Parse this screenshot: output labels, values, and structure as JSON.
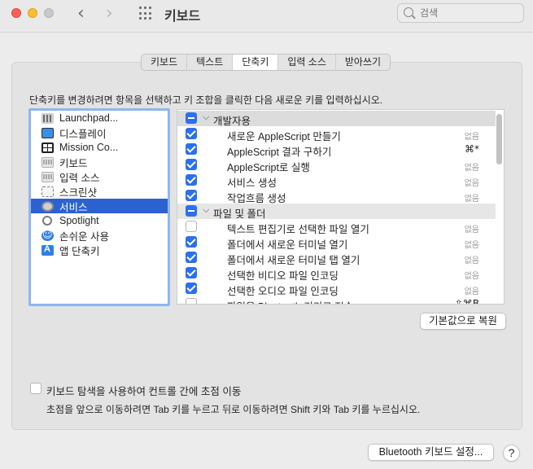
{
  "window": {
    "title": "키보드",
    "search_placeholder": "검색"
  },
  "tabs": [
    {
      "label": "키보드"
    },
    {
      "label": "텍스트"
    },
    {
      "label": "단축키"
    },
    {
      "label": "입력 소스"
    },
    {
      "label": "받아쓰기"
    }
  ],
  "active_tab": "단축키",
  "instruction": "단축키를 변경하려면 항목을 선택하고 키 조합을 클릭한 다음 새로운 키를 입력하십시오.",
  "categories": [
    {
      "label": "Launchpad...",
      "icon": "launchpad-icon"
    },
    {
      "label": "디스플레이",
      "icon": "display-icon"
    },
    {
      "label": "Mission Co...",
      "icon": "mission-control-icon"
    },
    {
      "label": "키보드",
      "icon": "keyboard-icon"
    },
    {
      "label": "입력 소스",
      "icon": "input-source-icon"
    },
    {
      "label": "스크린샷",
      "icon": "screenshot-icon"
    },
    {
      "label": "서비스",
      "icon": "services-icon",
      "selected": true
    },
    {
      "label": "Spotlight",
      "icon": "spotlight-icon"
    },
    {
      "label": "손쉬운 사용",
      "icon": "accessibility-icon"
    },
    {
      "label": "앱 단축키",
      "icon": "app-shortcuts-icon"
    }
  ],
  "shortcuts": [
    {
      "type": "group",
      "label": "개발자용",
      "state": "mixed"
    },
    {
      "type": "item",
      "label": "새로운 AppleScript 만들기",
      "checked": true,
      "key": "없음"
    },
    {
      "type": "item",
      "label": "AppleScript 결과 구하기",
      "checked": true,
      "key": "⌘*"
    },
    {
      "type": "item",
      "label": "AppleScript로 실행",
      "checked": true,
      "key": "없음"
    },
    {
      "type": "item",
      "label": "서비스 생성",
      "checked": true,
      "key": "없음"
    },
    {
      "type": "item",
      "label": "작업흐름 생성",
      "checked": true,
      "key": "없음"
    },
    {
      "type": "group",
      "label": "파일 및 폴더",
      "state": "mixed"
    },
    {
      "type": "item",
      "label": "텍스트 편집기로 선택한 파일 열기",
      "checked": false,
      "key": "없음"
    },
    {
      "type": "item",
      "label": "폴더에서 새로운 터미널 열기",
      "checked": true,
      "key": "없음"
    },
    {
      "type": "item",
      "label": "폴더에서 새로운 터미널 탭 열기",
      "checked": true,
      "key": "없음"
    },
    {
      "type": "item",
      "label": "선택한 비디오 파일 인코딩",
      "checked": true,
      "key": "없음"
    },
    {
      "type": "item",
      "label": "선택한 오디오 파일 인코딩",
      "checked": true,
      "key": "없음"
    },
    {
      "type": "item",
      "label": "파일을 Bluetooth 기기로 전송",
      "checked": false,
      "key": "⇧⌘B"
    }
  ],
  "restore_button": "기본값으로 복원",
  "keyboard_nav": {
    "label": "키보드 탐색을 사용하여 컨트롤 간에 초점 이동",
    "checked": false,
    "note": "초점을 앞으로 이동하려면 Tab 키를 누르고 뒤로 이동하려면 Shift 키와 Tab 키를 누르십시오."
  },
  "bluetooth_button": "Bluetooth 키보드 설정...",
  "help_button": "?",
  "colors": {
    "accent": "#2c62d0",
    "checkbox_on": "#2c6ff0",
    "close": "#fe5f57",
    "minimize": "#febc2e"
  }
}
